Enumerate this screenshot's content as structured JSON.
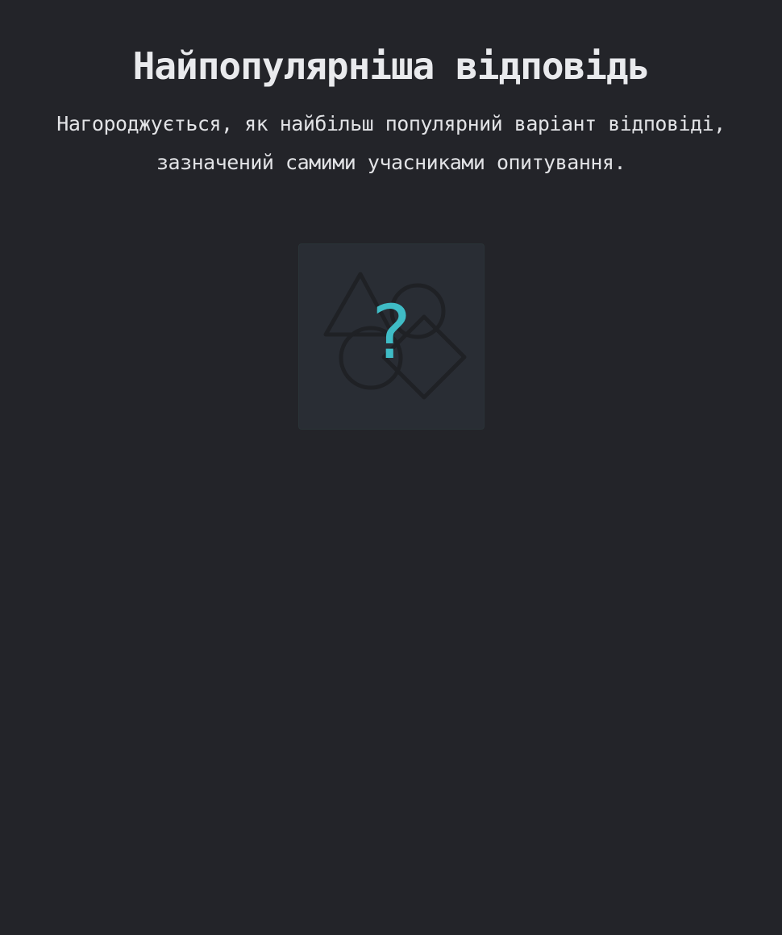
{
  "header": {
    "title": "Найпопулярніша відповідь",
    "description": "Нагороджується, як найбільш популярний варіант відповіді, зазначений самими учасниками опитування."
  },
  "badge": {
    "icon": "question-mark-icon",
    "glyph": "?",
    "accent_color": "#3fbcc6",
    "background_shapes": [
      "triangle-icon",
      "circle-icon",
      "circle-icon",
      "diamond-icon"
    ]
  }
}
